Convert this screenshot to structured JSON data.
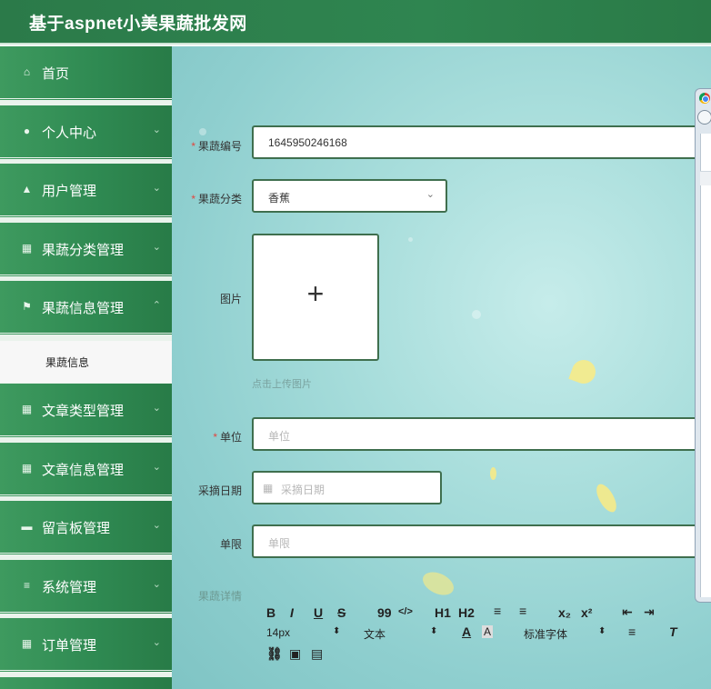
{
  "app": {
    "title": "基于aspnet小美果蔬批发网"
  },
  "sidebar": {
    "items": [
      {
        "label": "首页",
        "icon": "home-icon",
        "glyph": "⌂",
        "arrow": ""
      },
      {
        "label": "个人中心",
        "icon": "user-icon",
        "glyph": "●",
        "arrow": "⌄"
      },
      {
        "label": "用户管理",
        "icon": "users-icon",
        "glyph": "▲",
        "arrow": "⌄"
      },
      {
        "label": "果蔬分类管理",
        "icon": "grid-icon",
        "glyph": "▦",
        "arrow": "⌄"
      },
      {
        "label": "果蔬信息管理",
        "icon": "flag-icon",
        "glyph": "⚑",
        "arrow": "⌃"
      },
      {
        "label": "文章类型管理",
        "icon": "grid-icon",
        "glyph": "▦",
        "arrow": "⌄"
      },
      {
        "label": "文章信息管理",
        "icon": "table-icon",
        "glyph": "▦",
        "arrow": "⌄"
      },
      {
        "label": "留言板管理",
        "icon": "message-icon",
        "glyph": "▬",
        "arrow": "⌄"
      },
      {
        "label": "系统管理",
        "icon": "menu-icon",
        "glyph": "≡",
        "arrow": "⌄"
      },
      {
        "label": "订单管理",
        "icon": "grid-icon",
        "glyph": "▦",
        "arrow": "⌄"
      }
    ],
    "subitems": [
      {
        "label": "果蔬信息"
      }
    ]
  },
  "form": {
    "code": {
      "label": "果蔬编号",
      "value": "1645950246168"
    },
    "category": {
      "label": "果蔬分类",
      "value": "香蕉"
    },
    "image": {
      "label": "图片",
      "plus": "+",
      "hint": "点击上传图片"
    },
    "unit": {
      "label": "单位",
      "placeholder": "单位"
    },
    "pick_date": {
      "label": "采摘日期",
      "placeholder": "采摘日期"
    },
    "limit": {
      "label": "单限",
      "placeholder": "单限"
    },
    "detail": {
      "label": "果蔬详情"
    }
  },
  "editor": {
    "row1": [
      "B",
      "I",
      "U",
      "S",
      "99",
      "</>",
      "H1",
      "H2",
      "≡",
      "≡",
      "x₂",
      "x²",
      "⇤",
      "⇥"
    ],
    "row2": {
      "size": "14px",
      "format": "文本",
      "font": "标准字体",
      "clear": "T"
    },
    "size_arrow": "⬍",
    "format_arrow": "⬍",
    "font_arrow": "⬍"
  },
  "colors": {
    "header": "#2b7a49",
    "sidebar": "#2f8a52",
    "required": "#e2463f",
    "border": "#3f6f4e"
  }
}
